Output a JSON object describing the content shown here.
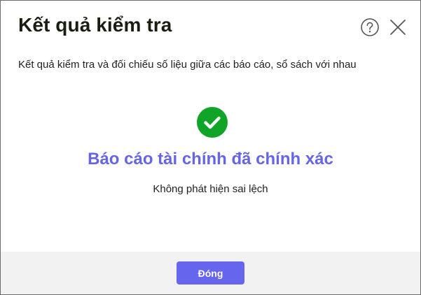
{
  "dialog": {
    "title": "Kết quả kiểm tra",
    "description": "Kết quả kiểm tra và đối chiếu số liệu giữa các báo cáo, sổ sách với nhau",
    "help_icon": "question-circle-icon",
    "close_icon": "close-x-icon"
  },
  "result": {
    "status_icon": "check-circle-icon",
    "status_color": "#10a528",
    "title": "Báo cáo tài chính đã chính xác",
    "title_color": "#6565e6",
    "subtitle": "Không phát hiện sai lệch"
  },
  "footer": {
    "close_label": "Đóng",
    "accent_color": "#6565ee"
  }
}
